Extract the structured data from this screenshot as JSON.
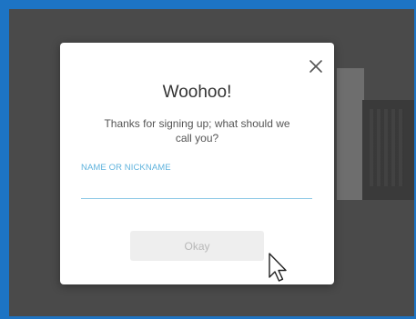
{
  "dialog": {
    "title": "Woohoo!",
    "message": "Thanks for signing up; what should we call you?",
    "field": {
      "label": "NAME OR NICKNAME",
      "value": "",
      "placeholder": ""
    },
    "okay_label": "Okay",
    "close_icon": "close-icon"
  },
  "colors": {
    "frame_border": "#1d74c4",
    "backdrop": "#4a4a4a",
    "label_accent": "#5fb3dd",
    "button_disabled_bg": "#eeeeee",
    "button_disabled_text": "#b8b8b8"
  },
  "cursor_icon": "mouse-pointer-icon"
}
